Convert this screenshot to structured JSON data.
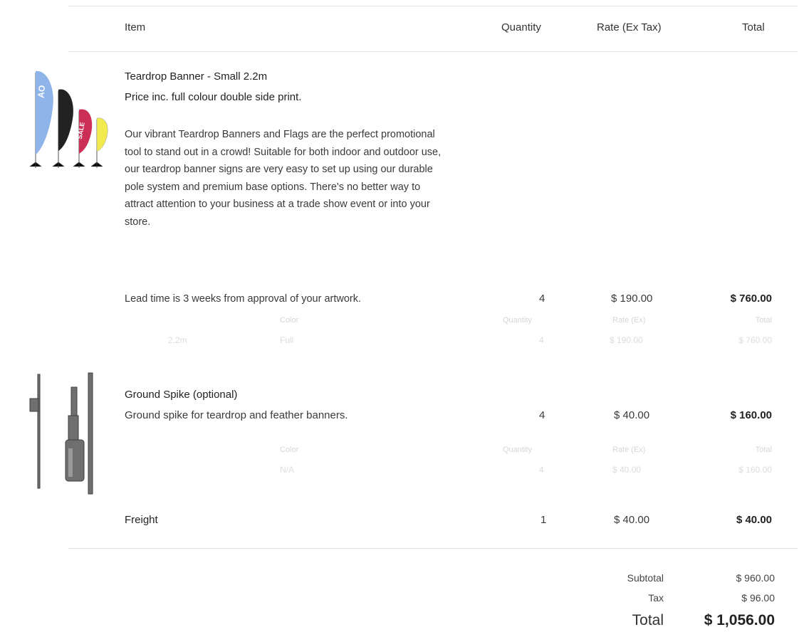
{
  "header": {
    "item": "Item",
    "quantity": "Quantity",
    "rate": "Rate (Ex Tax)",
    "total": "Total"
  },
  "items": [
    {
      "title": "Teardrop Banner - Small 2.2m",
      "subtitle": "Price inc. full colour double side print.",
      "description": "Our vibrant Teardrop Banners and Flags are the perfect promotional tool to stand out in a crowd! Suitable for both indoor and outdoor use, our teardrop banner signs are very easy to set up using our durable pole system and premium base options. There's no better way to attract attention to your business at a trade show event or into your store.",
      "lead_time": "Lead time is 3 weeks from approval of your artwork.",
      "quantity": "4",
      "rate": "$ 190.00",
      "total": "$ 760.00",
      "variant": {
        "headers": [
          "Color",
          "Quantity",
          "Rate (Ex)",
          "Total"
        ],
        "size": "2.2m",
        "color": "Full",
        "quantity": "4",
        "rate": "$ 190.00",
        "total": "$ 760.00"
      }
    },
    {
      "title": "Ground Spike (optional)",
      "description": "Ground spike for teardrop and feather banners.",
      "quantity": "4",
      "rate": "$ 40.00",
      "total": "$ 160.00",
      "variant": {
        "headers": [
          "Color",
          "Quantity",
          "Rate (Ex)",
          "Total"
        ],
        "color": "N/A",
        "quantity": "4",
        "rate": "$ 40.00",
        "total": "$ 160.00"
      }
    },
    {
      "title": "Freight",
      "quantity": "1",
      "rate": "$ 40.00",
      "total": "$ 40.00"
    }
  ],
  "summary": {
    "subtotal_label": "Subtotal",
    "subtotal": "$ 960.00",
    "tax_label": "Tax",
    "tax": "$ 96.00",
    "total_label": "Total",
    "total": "$ 1,056.00"
  },
  "flag_text": {
    "flag1": "AO",
    "flag3": "SALE"
  },
  "colors": {
    "flag_blue": "#8fb4ea",
    "flag_black": "#222222",
    "flag_red": "#cc2f55",
    "flag_yellow": "#f3ea4f"
  }
}
